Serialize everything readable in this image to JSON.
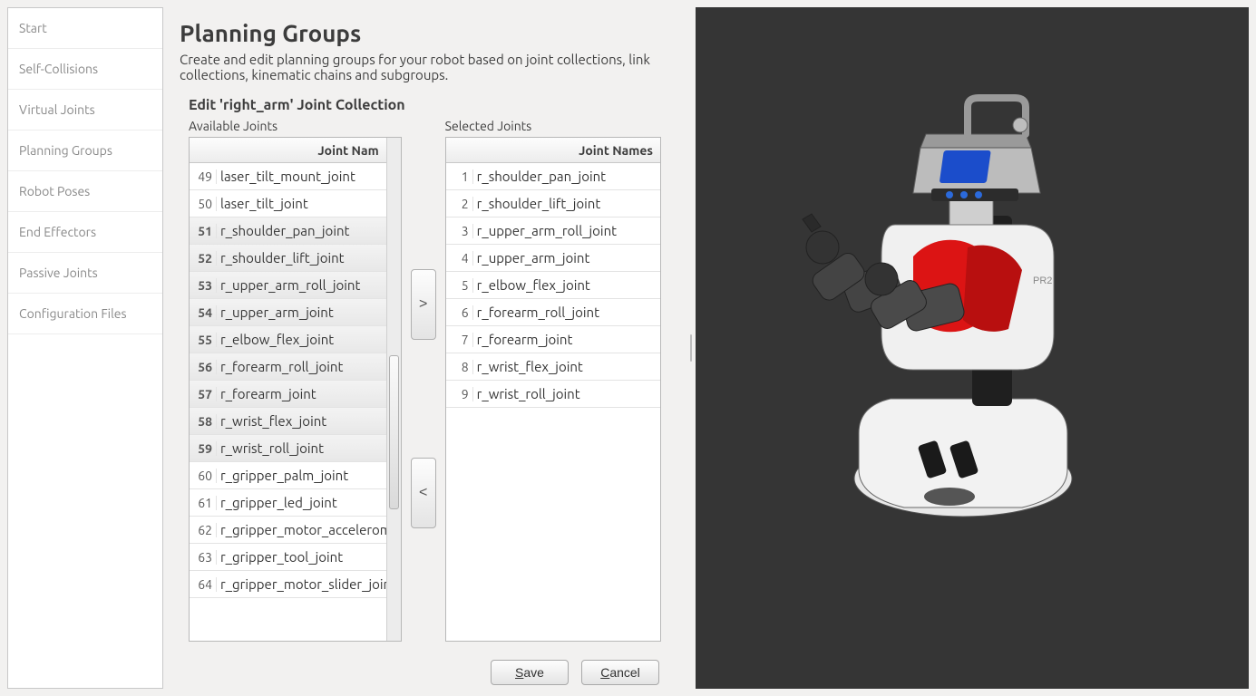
{
  "sidebar": {
    "items": [
      {
        "label": "Start"
      },
      {
        "label": "Self-Collisions"
      },
      {
        "label": "Virtual Joints"
      },
      {
        "label": "Planning Groups"
      },
      {
        "label": "Robot Poses"
      },
      {
        "label": "End Effectors"
      },
      {
        "label": "Passive Joints"
      },
      {
        "label": "Configuration Files"
      }
    ]
  },
  "main": {
    "title": "Planning Groups",
    "subtitle": "Create and edit planning groups for your robot based on joint collections, link collections, kinematic chains and subgroups.",
    "edit_label": "Edit 'right_arm' Joint Collection",
    "available_label": "Available Joints",
    "selected_label": "Selected Joints",
    "header_available": "Joint Nam",
    "header_selected": "Joint Names",
    "available": [
      {
        "n": "49",
        "name": "laser_tilt_mount_joint",
        "hl": false
      },
      {
        "n": "50",
        "name": "laser_tilt_joint",
        "hl": false
      },
      {
        "n": "51",
        "name": "r_shoulder_pan_joint",
        "hl": true
      },
      {
        "n": "52",
        "name": "r_shoulder_lift_joint",
        "hl": true
      },
      {
        "n": "53",
        "name": "r_upper_arm_roll_joint",
        "hl": true
      },
      {
        "n": "54",
        "name": "r_upper_arm_joint",
        "hl": true
      },
      {
        "n": "55",
        "name": "r_elbow_flex_joint",
        "hl": true
      },
      {
        "n": "56",
        "name": "r_forearm_roll_joint",
        "hl": true
      },
      {
        "n": "57",
        "name": "r_forearm_joint",
        "hl": true
      },
      {
        "n": "58",
        "name": "r_wrist_flex_joint",
        "hl": true
      },
      {
        "n": "59",
        "name": "r_wrist_roll_joint",
        "hl": true
      },
      {
        "n": "60",
        "name": "r_gripper_palm_joint",
        "hl": false
      },
      {
        "n": "61",
        "name": "r_gripper_led_joint",
        "hl": false
      },
      {
        "n": "62",
        "name": "r_gripper_motor_accelerometer",
        "hl": false
      },
      {
        "n": "63",
        "name": "r_gripper_tool_joint",
        "hl": false
      },
      {
        "n": "64",
        "name": "r_gripper_motor_slider_joint",
        "hl": false
      }
    ],
    "selected": [
      {
        "n": "1",
        "name": "r_shoulder_pan_joint"
      },
      {
        "n": "2",
        "name": "r_shoulder_lift_joint"
      },
      {
        "n": "3",
        "name": "r_upper_arm_roll_joint"
      },
      {
        "n": "4",
        "name": "r_upper_arm_joint"
      },
      {
        "n": "5",
        "name": "r_elbow_flex_joint"
      },
      {
        "n": "6",
        "name": "r_forearm_roll_joint"
      },
      {
        "n": "7",
        "name": "r_forearm_joint"
      },
      {
        "n": "8",
        "name": "r_wrist_flex_joint"
      },
      {
        "n": "9",
        "name": "r_wrist_roll_joint"
      }
    ],
    "add_label": ">",
    "remove_label": "<",
    "save_label": "Save",
    "cancel_label": "Cancel"
  },
  "viewer": {
    "robot_model": "PR2",
    "bg_color": "#353535",
    "accent_color": "#e81010",
    "sensor_color": "#1b4dcb"
  }
}
